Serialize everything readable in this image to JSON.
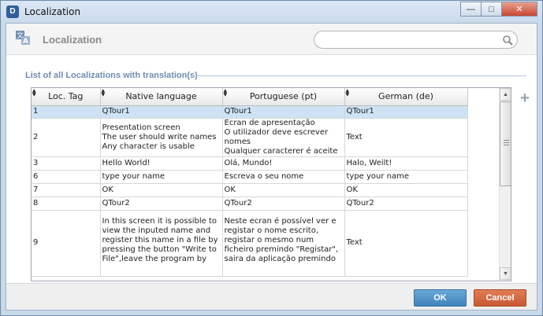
{
  "window": {
    "title": "Localization",
    "icon_letter": "D",
    "controls": [
      "minimize",
      "maximize",
      "close"
    ]
  },
  "header": {
    "title": "Localization",
    "search_placeholder": ""
  },
  "section_label": "List of all Localizations with translation(s)",
  "table": {
    "columns": [
      "Loc. Tag",
      "Native language",
      "Portuguese  (pt)",
      "German  (de)"
    ],
    "rows": [
      {
        "tag": "1",
        "native": "QTour1",
        "pt": "QTour1",
        "de": "QTour1",
        "selected": true
      },
      {
        "tag": "2",
        "native": "Presentation screen\nThe user should write names\nAny character is usable",
        "pt": "Ecran de apresentação\nO utilizador deve escrever nomes\nQualquer caracterer é aceite",
        "de": "Text",
        "selected": false
      },
      {
        "tag": "3",
        "native": "Hello World!",
        "pt": "Olá, Mundo!",
        "de": "Halo, Weilt!",
        "selected": false
      },
      {
        "tag": "6",
        "native": "type your name",
        "pt": "Escreva o seu nome",
        "de": "type your name",
        "selected": false
      },
      {
        "tag": "7",
        "native": "OK",
        "pt": "OK",
        "de": "OK",
        "selected": false
      },
      {
        "tag": "8",
        "native": "QTour2",
        "pt": "QTour2",
        "de": "QTour2",
        "selected": false
      },
      {
        "tag": "9",
        "native": "In this screen it is possible to view the inputed name and register this name in a file by pressing the button \"Write to File\",leave the program by pressing \"Leave\"",
        "pt": "Neste ecran é possível ver e registar o nome escrito, registar o mesmo num ficheiro premindo \"Registar\", saira da aplicação premindo \"Sair\" ou",
        "de": "Text",
        "selected": false
      }
    ]
  },
  "footer": {
    "ok_label": "OK",
    "cancel_label": "Cancel"
  },
  "colors": {
    "accent": "#4a8fc6",
    "cancel": "#d06a42",
    "section": "#6f8db2",
    "selected_row": "#cde3f5"
  }
}
